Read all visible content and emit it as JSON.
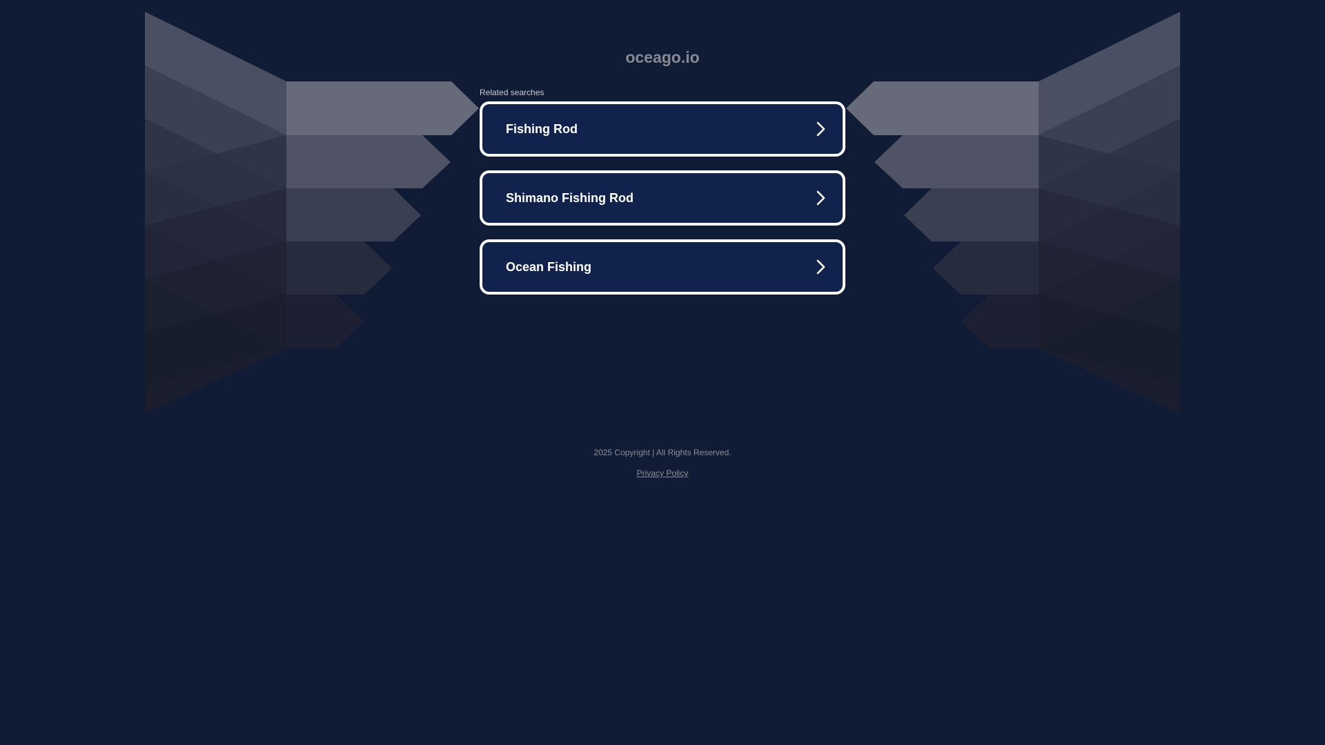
{
  "header": {
    "domain": "oceago.io"
  },
  "related": {
    "label": "Related searches",
    "items": [
      {
        "label": "Fishing Rod"
      },
      {
        "label": "Shimano Fishing Rod"
      },
      {
        "label": "Ocean Fishing"
      }
    ]
  },
  "footer": {
    "copyright": "2025 Copyright | All Rights Reserved.",
    "privacy_label": "Privacy Policy"
  },
  "icons": {
    "result_arrow": "chevron-right-icon"
  },
  "colors": {
    "background": "#101c36",
    "button_fill": "#11234c",
    "button_border": "#ffffff",
    "title_text": "#878a92"
  }
}
